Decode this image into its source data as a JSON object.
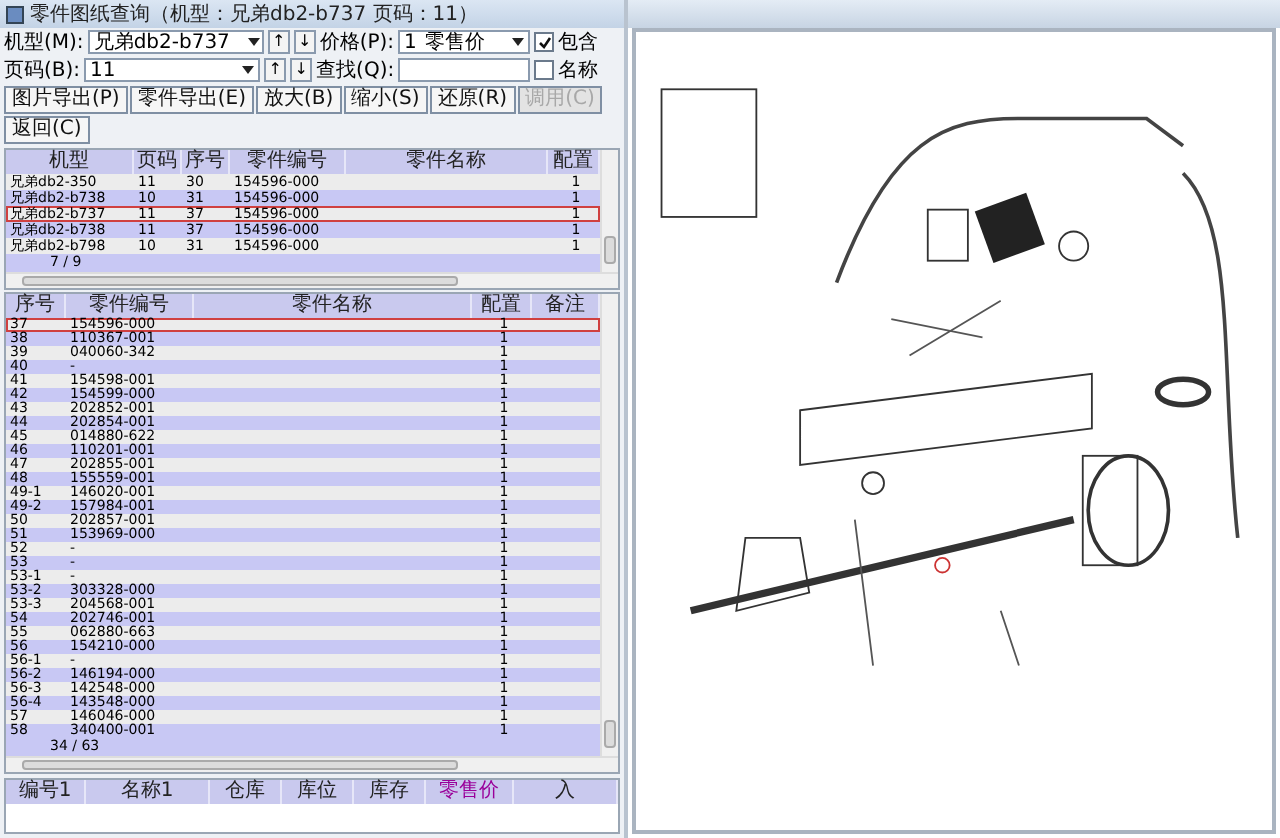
{
  "window": {
    "title": "零件图纸查询（机型：兄弟db2-b737 页码：11）"
  },
  "filter_rows": [
    {
      "label": "机型(M):",
      "value": "兄弟db2-b737",
      "up": "↑",
      "down": "↓",
      "label2": "价格(P):",
      "field2": {
        "kind": "select",
        "value": "1",
        "extra": "零售价"
      },
      "check_label": "包含",
      "checked": true
    },
    {
      "label": "页码(B):",
      "value": "11",
      "up": "↑",
      "down": "↓",
      "label2": "查找(Q):",
      "field2": {
        "kind": "input"
      },
      "check_label": "名称",
      "checked": false
    }
  ],
  "toolbar": [
    {
      "label": "图片导出(P)",
      "disabled": false
    },
    {
      "label": "零件导出(E)",
      "disabled": false
    },
    {
      "label": "放大(B)",
      "disabled": false
    },
    {
      "label": "缩小(S)",
      "disabled": false
    },
    {
      "label": "还原(R)",
      "disabled": false
    },
    {
      "label": "调用(C)",
      "disabled": true
    },
    {
      "label": "返回(C)",
      "disabled": false
    }
  ],
  "models_table": {
    "columns": [
      "机型",
      "页码",
      "序号",
      "零件编号",
      "零件名称",
      "配置"
    ],
    "rows": [
      {
        "cells": [
          "兄弟db2-350",
          "11",
          "30",
          "154596-000",
          "",
          "1"
        ],
        "selected": false
      },
      {
        "cells": [
          "兄弟db2-b738",
          "10",
          "31",
          "154596-000",
          "",
          "1"
        ],
        "selected": false
      },
      {
        "cells": [
          "兄弟db2-b737",
          "11",
          "37",
          "154596-000",
          "",
          "1"
        ],
        "selected": true
      },
      {
        "cells": [
          "兄弟db2-b738",
          "11",
          "37",
          "154596-000",
          "",
          "1"
        ],
        "selected": false
      },
      {
        "cells": [
          "兄弟db2-b798",
          "10",
          "31",
          "154596-000",
          "",
          "1"
        ],
        "selected": false
      }
    ],
    "footer": "7 / 9"
  },
  "parts_table": {
    "columns": [
      "序号",
      "零件编号",
      "零件名称",
      "配置",
      "备注"
    ],
    "rows": [
      {
        "cells": [
          "37",
          "154596-000",
          "1"
        ],
        "selected": true
      },
      {
        "cells": [
          "38",
          "110367-001",
          "1"
        ],
        "selected": false
      },
      {
        "cells": [
          "39",
          "040060-342",
          "1"
        ],
        "selected": false
      },
      {
        "cells": [
          "40",
          "-",
          "1"
        ],
        "selected": false
      },
      {
        "cells": [
          "41",
          "154598-001",
          "1"
        ],
        "selected": false
      },
      {
        "cells": [
          "42",
          "154599-000",
          "1"
        ],
        "selected": false
      },
      {
        "cells": [
          "43",
          "202852-001",
          "1"
        ],
        "selected": false
      },
      {
        "cells": [
          "44",
          "202854-001",
          "1"
        ],
        "selected": false
      },
      {
        "cells": [
          "45",
          "014880-622",
          "1"
        ],
        "selected": false
      },
      {
        "cells": [
          "46",
          "110201-001",
          "1"
        ],
        "selected": false
      },
      {
        "cells": [
          "47",
          "202855-001",
          "1"
        ],
        "selected": false
      },
      {
        "cells": [
          "48",
          "155559-001",
          "1"
        ],
        "selected": false
      },
      {
        "cells": [
          "49-1",
          "146020-001",
          "1"
        ],
        "selected": false
      },
      {
        "cells": [
          "49-2",
          "157984-001",
          "1"
        ],
        "selected": false
      },
      {
        "cells": [
          "50",
          "202857-001",
          "1"
        ],
        "selected": false
      },
      {
        "cells": [
          "51",
          "153969-000",
          "1"
        ],
        "selected": false
      },
      {
        "cells": [
          "52",
          "-",
          "1"
        ],
        "selected": false
      },
      {
        "cells": [
          "53",
          "-",
          "1"
        ],
        "selected": false
      },
      {
        "cells": [
          "53-1",
          "-",
          "1"
        ],
        "selected": false
      },
      {
        "cells": [
          "53-2",
          "303328-000",
          "1"
        ],
        "selected": false
      },
      {
        "cells": [
          "53-3",
          "204568-001",
          "1"
        ],
        "selected": false
      },
      {
        "cells": [
          "54",
          "202746-001",
          "1"
        ],
        "selected": false
      },
      {
        "cells": [
          "55",
          "062880-663",
          "1"
        ],
        "selected": false
      },
      {
        "cells": [
          "56",
          "154210-000",
          "1"
        ],
        "selected": false
      },
      {
        "cells": [
          "56-1",
          "-",
          "1"
        ],
        "selected": false
      },
      {
        "cells": [
          "56-2",
          "146194-000",
          "1"
        ],
        "selected": false
      },
      {
        "cells": [
          "56-3",
          "142548-000",
          "1"
        ],
        "selected": false
      },
      {
        "cells": [
          "56-4",
          "143548-000",
          "1"
        ],
        "selected": false
      },
      {
        "cells": [
          "57",
          "146046-000",
          "1"
        ],
        "selected": false
      },
      {
        "cells": [
          "58",
          "340400-001",
          "1"
        ],
        "selected": false
      }
    ],
    "footer": "34 / 63"
  },
  "stock_table": {
    "columns": [
      {
        "label": "编号1",
        "highlighted": false
      },
      {
        "label": "名称1",
        "highlighted": false
      },
      {
        "label": "仓库",
        "highlighted": false
      },
      {
        "label": "库位",
        "highlighted": false
      },
      {
        "label": "库存",
        "highlighted": false
      },
      {
        "label": "零售价",
        "highlighted": true
      },
      {
        "label": "入",
        "highlighted": false
      }
    ]
  }
}
